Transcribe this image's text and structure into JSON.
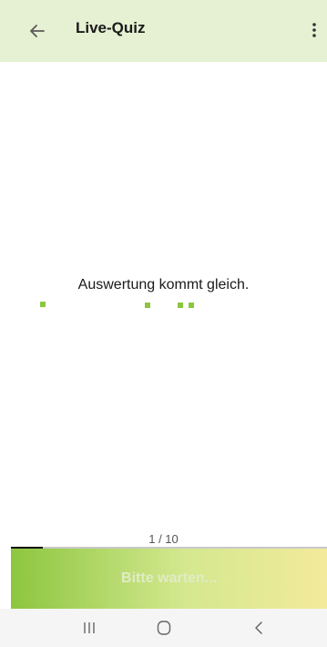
{
  "app_bar": {
    "title": "Live-Quiz",
    "background_color": "#e6f0d2",
    "back_icon": "arrow-left-icon",
    "menu_icon": "more-vertical-icon"
  },
  "main": {
    "message": "Auswertung kommt gleich.",
    "loading_indicator": {
      "type": "animated-dots",
      "color": "#8cc63f"
    }
  },
  "question_progress": {
    "label": "1 / 10",
    "current": 1,
    "total": 10,
    "fill_fraction": 0.1
  },
  "action_button": {
    "label": "Bitte warten...",
    "state": "disabled",
    "gradient": [
      "#8cc63f",
      "#f3ea9c"
    ]
  },
  "system_nav": {
    "recents_icon": "recents-icon",
    "home_icon": "home-icon",
    "back_icon": "system-back-icon"
  }
}
